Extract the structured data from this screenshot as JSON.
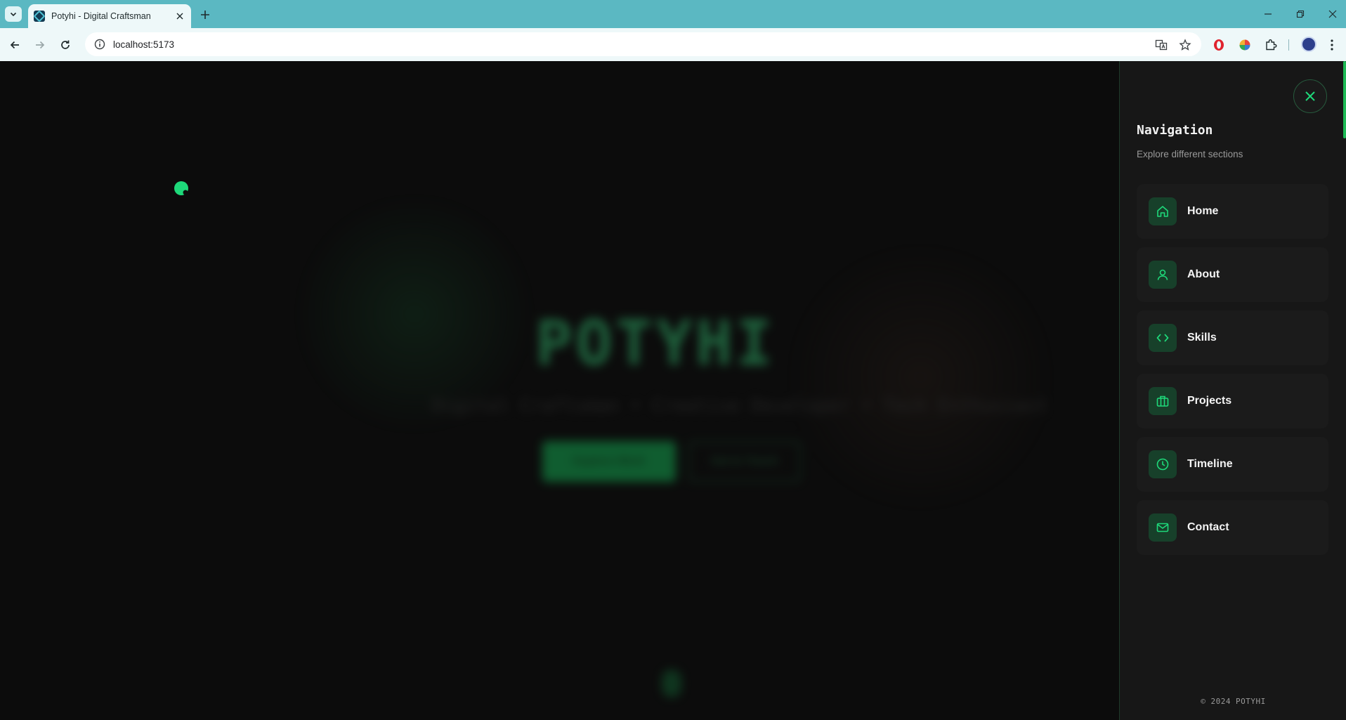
{
  "browser": {
    "tab_title": "Potyhi - Digital Craftsman",
    "url": "localhost:5173"
  },
  "hero": {
    "title": "POTYHI",
    "subtitle": "Digital Craftsman • Creative Developer • Tech Enthusiast",
    "primary_button": "Explore Work",
    "secondary_button": "Get In Touch"
  },
  "drawer": {
    "title": "Navigation",
    "subtitle": "Explore different sections",
    "items": [
      {
        "label": "Home",
        "icon": "home-icon"
      },
      {
        "label": "About",
        "icon": "user-icon"
      },
      {
        "label": "Skills",
        "icon": "code-icon"
      },
      {
        "label": "Projects",
        "icon": "briefcase-icon"
      },
      {
        "label": "Timeline",
        "icon": "clock-icon"
      },
      {
        "label": "Contact",
        "icon": "mail-icon"
      }
    ],
    "footer": "© 2024 POTYHI"
  },
  "colors": {
    "accent": "#1db954",
    "drawer_bg": "#171717",
    "page_bg": "#0c0c0c",
    "chrome": "#5bb8c2"
  }
}
